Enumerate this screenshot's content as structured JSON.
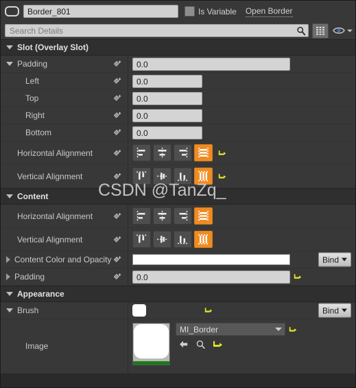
{
  "header": {
    "widget_icon": "rounded-rect-border-icon",
    "name_value": "Border_801",
    "is_variable_label": "Is Variable",
    "is_variable_checked": false,
    "open_link_label": "Open Border"
  },
  "search": {
    "placeholder": "Search Details",
    "search_icon": "magnifier-icon",
    "grid_button_icon": "grid-view-icon",
    "eye_button_icon": "eye-icon"
  },
  "watermark": "CSDN @TanZq_",
  "colors": {
    "accent_orange": "#ef8b23",
    "panel_bg": "#383838",
    "section_bg": "#2f2f2f",
    "field_bg": "#d4d4d4",
    "reset_yellow": "#e8e827",
    "thumb_green": "#1b7a1b",
    "swatch_white": "#ffffff"
  },
  "sections": [
    {
      "title": "Slot (Overlay Slot)",
      "rows": [
        {
          "label": "Padding",
          "type": "number",
          "value": "0.0",
          "indent": 1,
          "expander": "down"
        },
        {
          "label": "Left",
          "type": "number",
          "value": "0.0",
          "indent": 3
        },
        {
          "label": "Top",
          "type": "number",
          "value": "0.0",
          "indent": 3
        },
        {
          "label": "Right",
          "type": "number",
          "value": "0.0",
          "indent": 3
        },
        {
          "label": "Bottom",
          "type": "number",
          "value": "0.0",
          "indent": 3
        },
        {
          "label": "Horizontal Alignment",
          "type": "align-h",
          "indent": 2,
          "options": [
            "Left Align",
            "Center Align",
            "Right Align",
            "Fill"
          ],
          "selected": 3,
          "reset": true
        },
        {
          "label": "Vertical Alignment",
          "type": "align-v",
          "indent": 2,
          "options": [
            "Top Align",
            "Center Align",
            "Bottom Align",
            "Fill"
          ],
          "selected": 3,
          "reset": true
        }
      ]
    },
    {
      "title": "Content",
      "rows": [
        {
          "label": "Horizontal Alignment",
          "type": "align-h",
          "indent": 2,
          "options": [
            "Left Align",
            "Center Align",
            "Right Align",
            "Fill"
          ],
          "selected": 3
        },
        {
          "label": "Vertical Alignment",
          "type": "align-v",
          "indent": 2,
          "options": [
            "Top Align",
            "Center Align",
            "Bottom Align",
            "Fill"
          ],
          "selected": 3
        },
        {
          "label": "Content Color and Opacity",
          "type": "color",
          "indent": 1,
          "expander": "right",
          "color": "#ffffff",
          "bind_label": "Bind"
        },
        {
          "label": "Padding",
          "type": "number",
          "value": "0.0",
          "indent": 1,
          "expander": "right",
          "reset": true
        }
      ]
    },
    {
      "title": "Appearance",
      "rows": [
        {
          "label": "Brush",
          "type": "brush",
          "indent": 1,
          "expander": "down",
          "swatch": "#ffffff",
          "reset": true,
          "bind_label": "Bind"
        },
        {
          "label": "Image",
          "type": "image",
          "indent": 2,
          "asset_name": "MI_Border",
          "thumb_green_bar": true,
          "mini_icons": [
            "use-selected-asset-icon",
            "browse-asset-icon",
            "reset-to-default-icon"
          ],
          "reset": true
        }
      ]
    }
  ]
}
